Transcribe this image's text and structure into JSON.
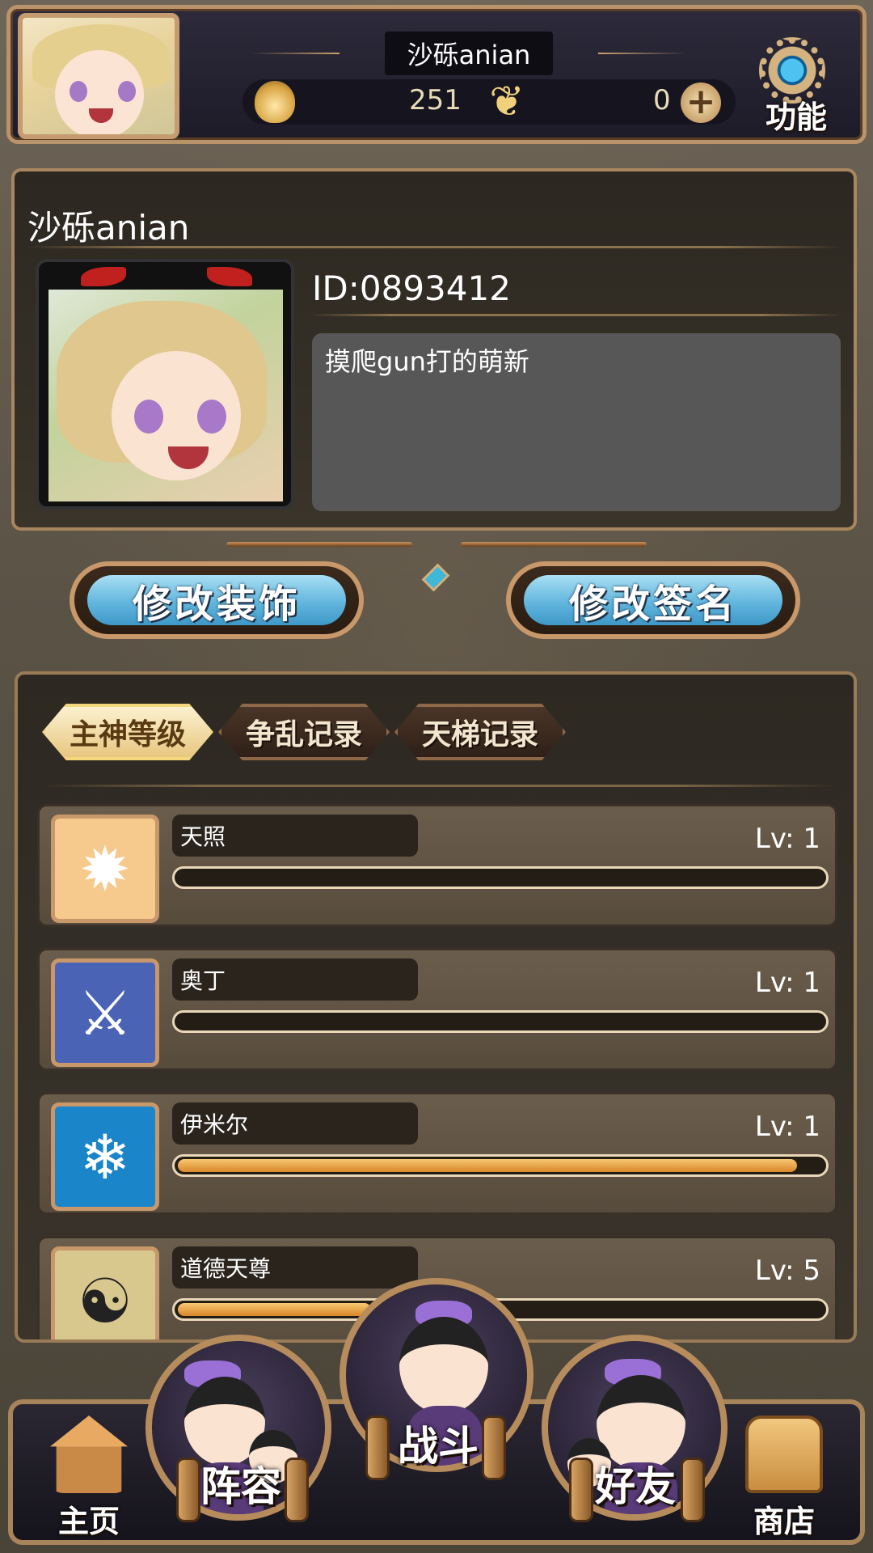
{
  "top_bar": {
    "player_name": "沙砾anian",
    "flame_icon": "flame-currency-icon",
    "currency_1": "251",
    "butterfly_icon": "butterfly-currency-icon",
    "currency_2": "0",
    "function_label": "功能"
  },
  "profile": {
    "name": "沙砾anian",
    "id": "ID:0893412",
    "signature": "摸爬gun打的萌新"
  },
  "actions": {
    "edit_decoration": "修改装饰",
    "edit_signature": "修改签名"
  },
  "tabs": [
    {
      "label": "主神等级",
      "active": true
    },
    {
      "label": "争乱记录",
      "active": false
    },
    {
      "label": "天梯记录",
      "active": false
    }
  ],
  "gods": [
    {
      "name": "天照",
      "level": "Lv: 1",
      "progress": 0.0,
      "icon": "sun-emblem-icon",
      "icon_color": "#f6c98d"
    },
    {
      "name": "奥丁",
      "level": "Lv: 1",
      "progress": 0.0,
      "icon": "winged-sword-icon",
      "icon_color": "#4a63b5"
    },
    {
      "name": "伊米尔",
      "level": "Lv: 1",
      "progress": 0.96,
      "icon": "ice-skull-icon",
      "icon_color": "#1a86c9"
    },
    {
      "name": "道德天尊",
      "level": "Lv: 5",
      "progress": 0.3,
      "icon": "yin-yang-icon",
      "icon_color": "#d9c88e"
    }
  ],
  "nav": {
    "home": "主页",
    "lineup": "阵容",
    "battle": "战斗",
    "friends": "好友",
    "shop": "商店"
  },
  "colors": {
    "accent_gold": "#c9986a",
    "button_blue": "#62b6de",
    "progress_orange": "#d98729"
  }
}
